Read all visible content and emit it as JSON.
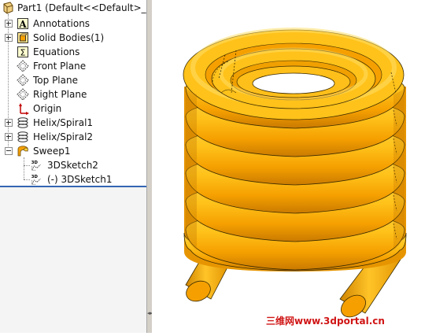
{
  "tree": {
    "root_label": "Part1  (Default<<Default>_",
    "items": [
      {
        "label": "Annotations",
        "icon": "annotations-icon",
        "expander": "plus"
      },
      {
        "label": "Solid Bodies(1)",
        "icon": "solid-bodies-icon",
        "expander": "plus"
      },
      {
        "label": "Equations",
        "icon": "equations-icon",
        "expander": "none"
      },
      {
        "label": "Front Plane",
        "icon": "plane-icon",
        "expander": "none"
      },
      {
        "label": "Top Plane",
        "icon": "plane-icon",
        "expander": "none"
      },
      {
        "label": "Right Plane",
        "icon": "plane-icon",
        "expander": "none"
      },
      {
        "label": "Origin",
        "icon": "origin-icon",
        "expander": "none"
      },
      {
        "label": "Helix/Spiral1",
        "icon": "helix-icon",
        "expander": "plus"
      },
      {
        "label": "Helix/Spiral2",
        "icon": "helix-icon",
        "expander": "plus"
      },
      {
        "label": "Sweep1",
        "icon": "sweep-icon",
        "expander": "minus"
      }
    ],
    "sweep_children": [
      {
        "label": "3DSketch2",
        "icon": "3d-sketch-icon"
      },
      {
        "label": "(-) 3DSketch1",
        "icon": "3d-sketch-icon"
      }
    ],
    "icon_glyphs": {
      "annotations": "A",
      "equations": "Σ",
      "sketch3d": "3D"
    }
  },
  "viewport": {
    "model": "helical-coil-sweep",
    "coil_color": "#f5a000",
    "coil_shadow": "#d88400",
    "coil_highlight": "#ffd23c"
  },
  "watermark": "三维网www.3dportal.cn"
}
